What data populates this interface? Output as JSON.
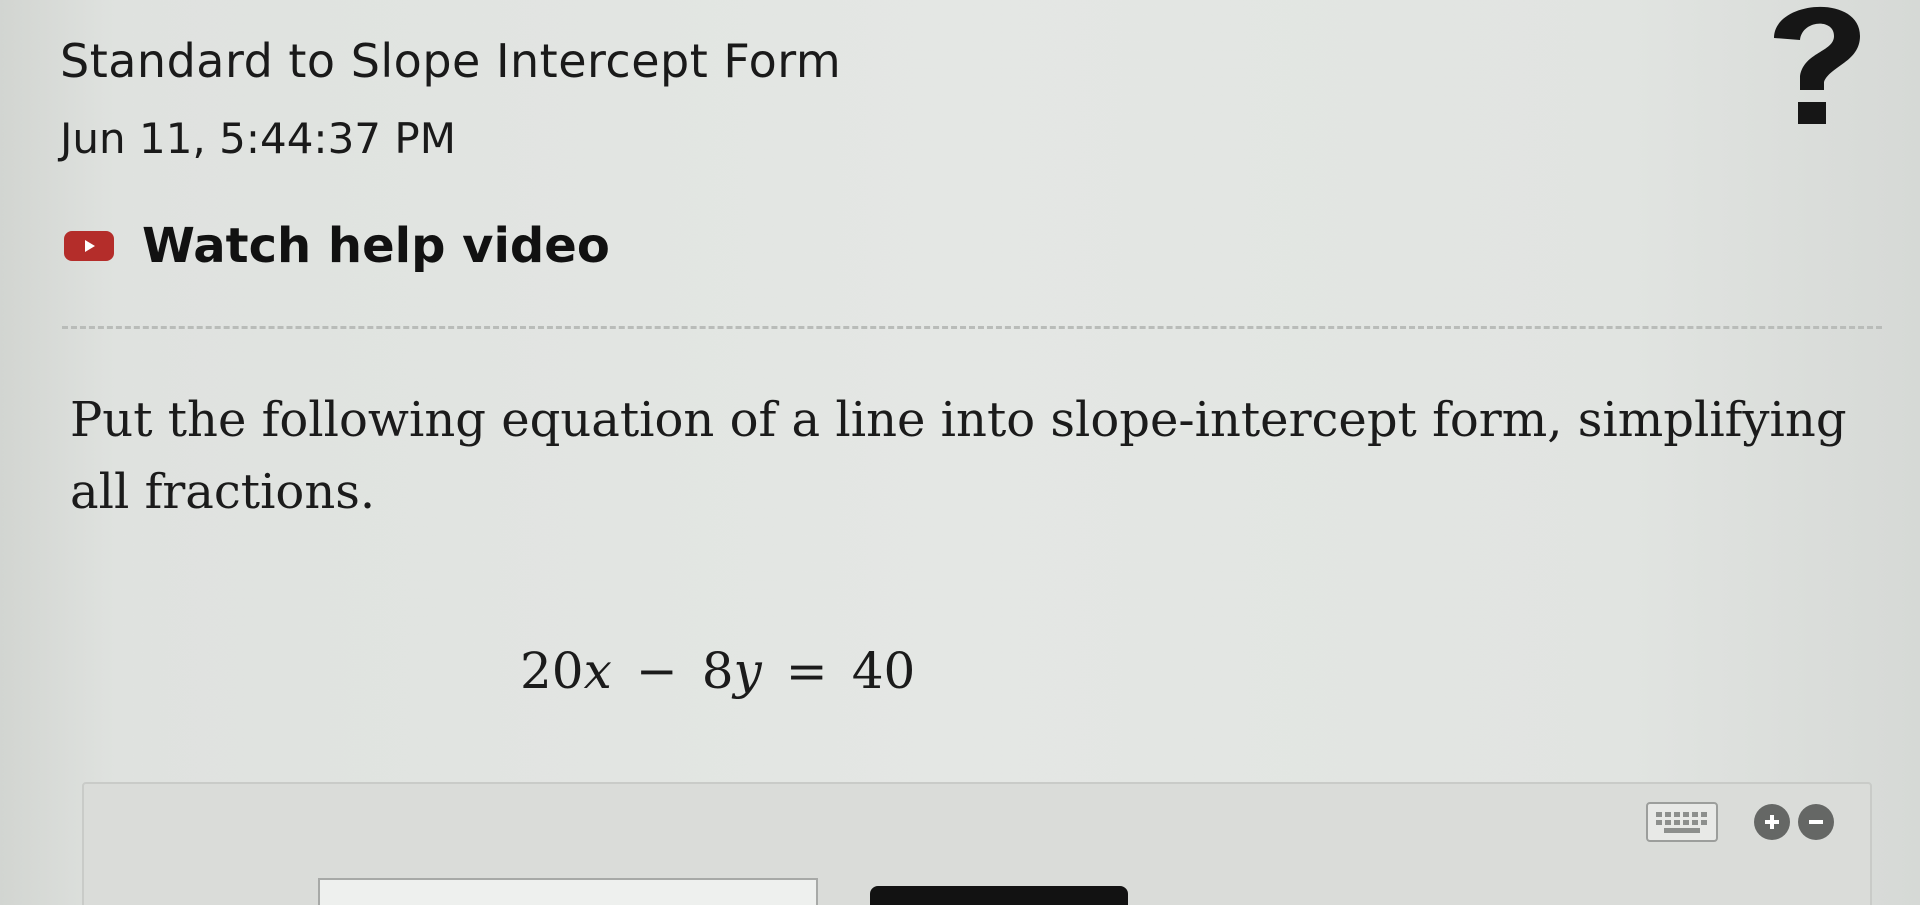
{
  "header": {
    "topic_title": "Standard to Slope Intercept Form",
    "timestamp": "Jun 11, 5:44:37 PM",
    "help_video_label": "Watch help video"
  },
  "problem": {
    "prompt": "Put the following equation of a line into slope-intercept form, simplifying all fractions.",
    "equation": {
      "term1_coefficient": "20",
      "term1_variable": "x",
      "operator1": "−",
      "term2_coefficient": "8",
      "term2_variable": "y",
      "equals": "=",
      "rhs": "40"
    }
  },
  "icons": {
    "help": "question-mark-icon",
    "video": "play-video-icon",
    "keyboard": "keyboard-icon",
    "zoom_in": "plus-circle-icon",
    "zoom_out": "minus-circle-icon"
  },
  "colors": {
    "video_icon": "#b42d2a",
    "submit_button": "#121212",
    "panel_background": "#dadcd9"
  }
}
